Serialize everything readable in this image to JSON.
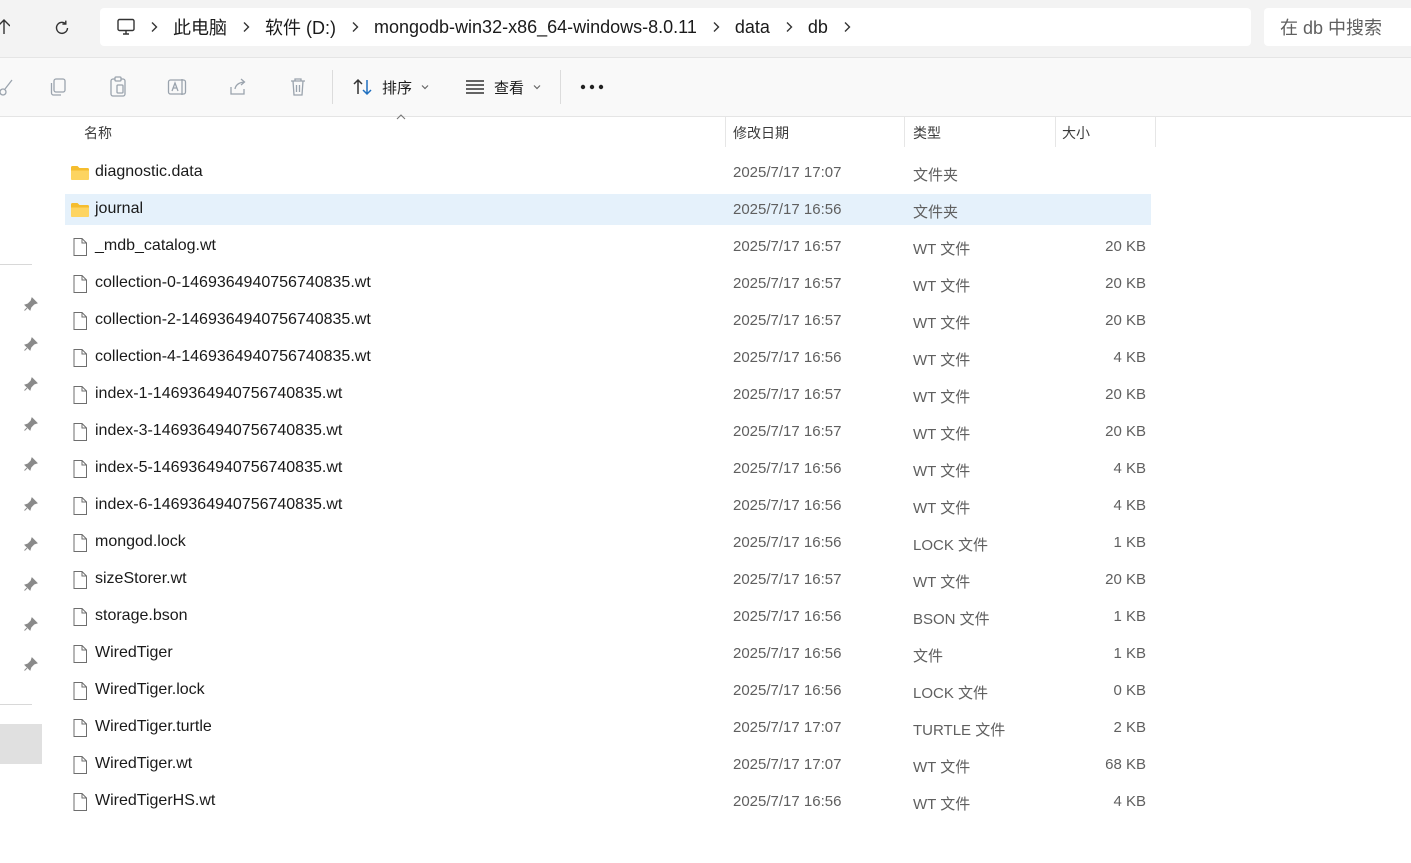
{
  "address_bar": {
    "crumbs": [
      "此电脑",
      "软件 (D:)",
      "mongodb-win32-x86_64-windows-8.0.11",
      "data",
      "db"
    ]
  },
  "search": {
    "placeholder": "在 db 中搜索"
  },
  "toolbar": {
    "sort_label": "排序",
    "view_label": "查看"
  },
  "columns": {
    "name": "名称",
    "modified": "修改日期",
    "type": "类型",
    "size": "大小"
  },
  "files": [
    {
      "name": "diagnostic.data",
      "modified": "2025/7/17 17:07",
      "type": "文件夹",
      "size": "",
      "icon": "folder-icon",
      "selected": false
    },
    {
      "name": "journal",
      "modified": "2025/7/17 16:56",
      "type": "文件夹",
      "size": "",
      "icon": "folder-icon",
      "selected": true
    },
    {
      "name": "_mdb_catalog.wt",
      "modified": "2025/7/17 16:57",
      "type": "WT 文件",
      "size": "20 KB",
      "icon": "file-icon",
      "selected": false
    },
    {
      "name": "collection-0-1469364940756740835.wt",
      "modified": "2025/7/17 16:57",
      "type": "WT 文件",
      "size": "20 KB",
      "icon": "file-icon",
      "selected": false
    },
    {
      "name": "collection-2-1469364940756740835.wt",
      "modified": "2025/7/17 16:57",
      "type": "WT 文件",
      "size": "20 KB",
      "icon": "file-icon",
      "selected": false
    },
    {
      "name": "collection-4-1469364940756740835.wt",
      "modified": "2025/7/17 16:56",
      "type": "WT 文件",
      "size": "4 KB",
      "icon": "file-icon",
      "selected": false
    },
    {
      "name": "index-1-1469364940756740835.wt",
      "modified": "2025/7/17 16:57",
      "type": "WT 文件",
      "size": "20 KB",
      "icon": "file-icon",
      "selected": false
    },
    {
      "name": "index-3-1469364940756740835.wt",
      "modified": "2025/7/17 16:57",
      "type": "WT 文件",
      "size": "20 KB",
      "icon": "file-icon",
      "selected": false
    },
    {
      "name": "index-5-1469364940756740835.wt",
      "modified": "2025/7/17 16:56",
      "type": "WT 文件",
      "size": "4 KB",
      "icon": "file-icon",
      "selected": false
    },
    {
      "name": "index-6-1469364940756740835.wt",
      "modified": "2025/7/17 16:56",
      "type": "WT 文件",
      "size": "4 KB",
      "icon": "file-icon",
      "selected": false
    },
    {
      "name": "mongod.lock",
      "modified": "2025/7/17 16:56",
      "type": "LOCK 文件",
      "size": "1 KB",
      "icon": "file-icon",
      "selected": false
    },
    {
      "name": "sizeStorer.wt",
      "modified": "2025/7/17 16:57",
      "type": "WT 文件",
      "size": "20 KB",
      "icon": "file-icon",
      "selected": false
    },
    {
      "name": "storage.bson",
      "modified": "2025/7/17 16:56",
      "type": "BSON 文件",
      "size": "1 KB",
      "icon": "file-icon",
      "selected": false
    },
    {
      "name": "WiredTiger",
      "modified": "2025/7/17 16:56",
      "type": "文件",
      "size": "1 KB",
      "icon": "file-icon",
      "selected": false
    },
    {
      "name": "WiredTiger.lock",
      "modified": "2025/7/17 16:56",
      "type": "LOCK 文件",
      "size": "0 KB",
      "icon": "file-icon",
      "selected": false
    },
    {
      "name": "WiredTiger.turtle",
      "modified": "2025/7/17 17:07",
      "type": "TURTLE 文件",
      "size": "2 KB",
      "icon": "file-icon",
      "selected": false
    },
    {
      "name": "WiredTiger.wt",
      "modified": "2025/7/17 17:07",
      "type": "WT 文件",
      "size": "68 KB",
      "icon": "file-icon",
      "selected": false
    },
    {
      "name": "WiredTigerHS.wt",
      "modified": "2025/7/17 16:56",
      "type": "WT 文件",
      "size": "4 KB",
      "icon": "file-icon",
      "selected": false
    }
  ],
  "colors": {
    "selection": "#e5f1fb",
    "folder": "#f8c53a",
    "chrome": "#f3f3f3"
  }
}
